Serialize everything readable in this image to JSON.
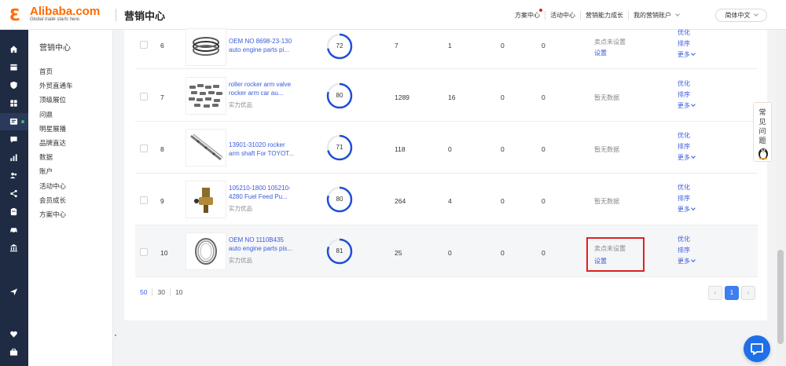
{
  "header": {
    "logo_mark": "Ɛ",
    "logo_name": "Alibaba.com",
    "logo_tagline": "Global trade starts here.",
    "page_title": "营销中心",
    "nav": [
      "方案中心",
      "活动中心",
      "营销能力成长",
      "我的营销账户"
    ],
    "language": "简体中文"
  },
  "rail_icons": [
    "home-icon",
    "store-icon",
    "shield-icon",
    "grid-icon",
    "marketing-icon",
    "chat-icon",
    "chart-icon",
    "users-icon",
    "share-icon",
    "clipboard-icon",
    "car-icon",
    "bank-icon",
    "send-icon",
    "heart-icon",
    "briefcase-icon"
  ],
  "menu": {
    "title": "营销中心",
    "items": [
      "首页",
      "外贸直通车",
      "顶级展位",
      "问鼎",
      "明星展播",
      "品牌直达",
      "数据",
      "账户",
      "活动中心",
      "会员成长",
      "方案中心"
    ]
  },
  "rows": [
    {
      "index": "6",
      "title": "OEM NO 8698-23-130 auto engine parts pi...",
      "badge": "",
      "score": 72,
      "c1": "7",
      "c2": "1",
      "c3": "0",
      "c4": "0",
      "status": "卖点未设置",
      "set_label": "设置",
      "highlight": false,
      "boxed": false
    },
    {
      "index": "7",
      "title": "roller rocker arm valve rocker arm car au...",
      "badge": "实力优品",
      "score": 80,
      "c1": "1289",
      "c2": "16",
      "c3": "0",
      "c4": "0",
      "status": "暂无数据",
      "set_label": "",
      "highlight": false,
      "boxed": false
    },
    {
      "index": "8",
      "title": "13901-31020 rocker arm shaft For TOYOT...",
      "badge": "",
      "score": 71,
      "c1": "118",
      "c2": "0",
      "c3": "0",
      "c4": "0",
      "status": "暂无数据",
      "set_label": "",
      "highlight": false,
      "boxed": false
    },
    {
      "index": "9",
      "title": "105210-1800 105210-4280 Fuel Feed Pu...",
      "badge": "实力优品",
      "score": 80,
      "c1": "264",
      "c2": "4",
      "c3": "0",
      "c4": "0",
      "status": "暂无数据",
      "set_label": "",
      "highlight": false,
      "boxed": false
    },
    {
      "index": "10",
      "title": "OEM NO 1110B435 auto engine parts pis...",
      "badge": "实力优品",
      "score": 81,
      "c1": "25",
      "c2": "0",
      "c3": "0",
      "c4": "0",
      "status": "卖点未设置",
      "set_label": "设置",
      "highlight": true,
      "boxed": true
    }
  ],
  "ops": {
    "optimize": "优化",
    "sort": "排序",
    "more": "更多"
  },
  "pager": {
    "sizes": [
      "50",
      "30",
      "10"
    ],
    "current": "1"
  },
  "faq": {
    "label": "常见问题"
  },
  "colors": {
    "accent": "#3b5bdb",
    "ring": "#1f4fd6",
    "brand": "#ff6a00",
    "rail": "#1f2a43",
    "highlight_box": "#e02020"
  }
}
